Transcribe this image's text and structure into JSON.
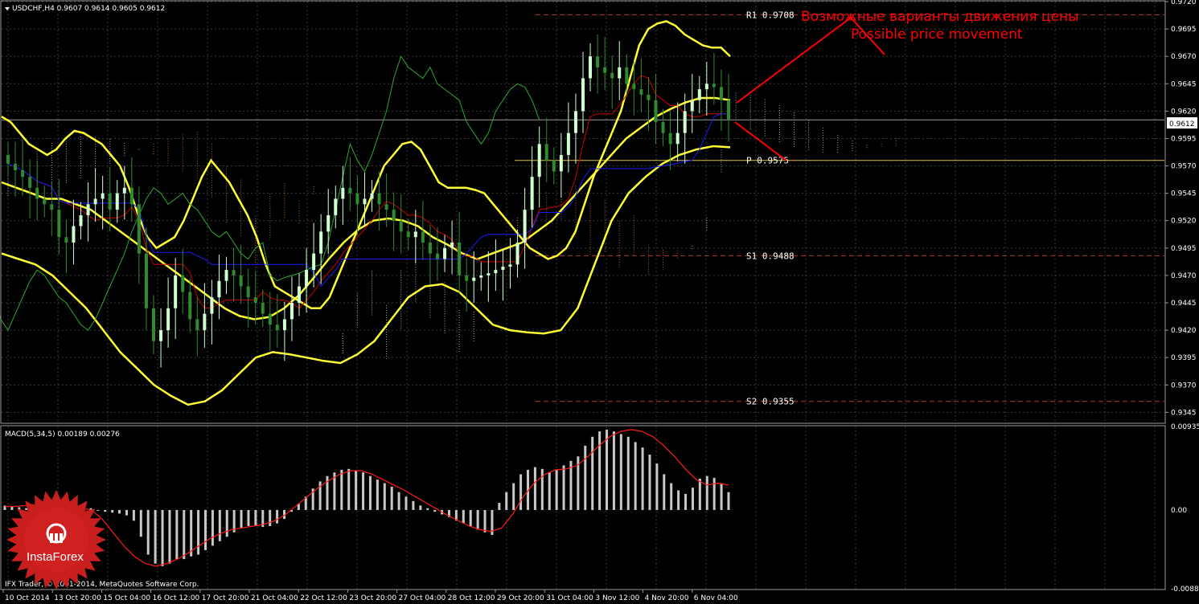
{
  "header": {
    "symbol_line": "USDCHF,H4 0.9607 0.9614 0.9605 0.9612"
  },
  "macd_header": "MACD(5,34,5) 0.00189 0.00276",
  "annotation": {
    "line1": "Возможные варианты движения цены",
    "line2": "Possible price movement"
  },
  "levels": [
    {
      "name": "R1",
      "label": "R1 0.9708",
      "value": 0.9708
    },
    {
      "name": "P",
      "label": "P 0.9575",
      "value": 0.9575
    },
    {
      "name": "S1",
      "label": "S1 0.9488",
      "value": 0.9488
    },
    {
      "name": "S2",
      "label": "S2 0.9355",
      "value": 0.9355
    }
  ],
  "current_price": "0.9612",
  "footer": "IFX Trader, © 2001-2014, MetaQuotes Software Corp.",
  "logo": {
    "text": "InstaForex"
  },
  "colors": {
    "background": "#000000",
    "grid": "#3a3a3a",
    "bull": "#d0ffd0",
    "bear": "#2e8b2e",
    "bollinger": "#ffff33",
    "tenkan": "#cc0000",
    "kijun": "#1a1aff",
    "chikou": "#2ea82e",
    "cloud": "#d8d8d8",
    "cloud_alt": "#e07a3a",
    "level_line": "#b03a2e",
    "pivot_line": "#e0c040",
    "annotation": "#ff0000",
    "macd_hist": "#c8c8c8",
    "macd_signal": "#ff1a1a",
    "logo": "#c81e1e"
  },
  "chart_data": [
    {
      "type": "candlestick",
      "title": "USDCHF,H4",
      "ylim": [
        0.9335,
        0.972
      ],
      "y_ticks": [
        "0.9720",
        "0.9695",
        "0.9670",
        "0.9645",
        "0.9620",
        "0.9595",
        "0.9570",
        "0.9545",
        "0.9520",
        "0.9495",
        "0.9470",
        "0.9445",
        "0.9420",
        "0.9395",
        "0.9370",
        "0.9345"
      ],
      "x_ticks": [
        "10 Oct 2014",
        "13 Oct 20:00",
        "15 Oct 04:00",
        "16 Oct 12:00",
        "17 Oct 20:00",
        "21 Oct 04:00",
        "22 Oct 12:00",
        "23 Oct 20:00",
        "27 Oct 04:00",
        "28 Oct 12:00",
        "29 Oct 20:00",
        "31 Oct 04:00",
        "3 Nov 12:00",
        "4 Nov 20:00",
        "6 Nov 04:00"
      ],
      "close": [
        0.9572,
        0.9566,
        0.956,
        0.955,
        0.954,
        0.9535,
        0.953,
        0.9505,
        0.95,
        0.9515,
        0.9525,
        0.9535,
        0.954,
        0.9545,
        0.953,
        0.9545,
        0.955,
        0.9535,
        0.949,
        0.944,
        0.941,
        0.942,
        0.944,
        0.947,
        0.9455,
        0.943,
        0.942,
        0.9435,
        0.945,
        0.9465,
        0.9475,
        0.947,
        0.946,
        0.945,
        0.9445,
        0.9435,
        0.9425,
        0.942,
        0.943,
        0.9445,
        0.946,
        0.9475,
        0.949,
        0.951,
        0.9525,
        0.954,
        0.955,
        0.9545,
        0.9535,
        0.954,
        0.9545,
        0.9535,
        0.953,
        0.952,
        0.951,
        0.9505,
        0.951,
        0.95,
        0.949,
        0.9485,
        0.9495,
        0.95,
        0.947,
        0.9465,
        0.9468,
        0.947,
        0.9472,
        0.9475,
        0.9478,
        0.948,
        0.95,
        0.953,
        0.956,
        0.959,
        0.9575,
        0.9565,
        0.958,
        0.96,
        0.962,
        0.965,
        0.967,
        0.966,
        0.9655,
        0.965,
        0.966,
        0.9645,
        0.964,
        0.9635,
        0.963,
        0.961,
        0.96,
        0.959,
        0.96,
        0.962,
        0.963,
        0.964,
        0.9645,
        0.9642,
        0.963,
        0.9612
      ],
      "bollinger_upper": [
        0.9615,
        0.961,
        0.96,
        0.959,
        0.9585,
        0.958,
        0.9585,
        0.9595,
        0.9602,
        0.96,
        0.9595,
        0.959,
        0.958,
        0.957,
        0.955,
        0.9525,
        0.9505,
        0.9495,
        0.95,
        0.9505,
        0.952,
        0.954,
        0.956,
        0.9575,
        0.9565,
        0.9555,
        0.954,
        0.9525,
        0.9505,
        0.948,
        0.946,
        0.9455,
        0.945,
        0.9445,
        0.944,
        0.944,
        0.945,
        0.947,
        0.949,
        0.951,
        0.953,
        0.955,
        0.957,
        0.958,
        0.959,
        0.9592,
        0.9585,
        0.957,
        0.9555,
        0.955,
        0.955,
        0.955,
        0.9548,
        0.9545,
        0.9535,
        0.9525,
        0.9515,
        0.9505,
        0.9495,
        0.949,
        0.9485,
        0.9488,
        0.9495,
        0.951,
        0.9535,
        0.956,
        0.958,
        0.96,
        0.962,
        0.965,
        0.968,
        0.9695,
        0.97,
        0.9702,
        0.9698,
        0.969,
        0.9685,
        0.968,
        0.9678,
        0.9678,
        0.967
      ],
      "bollinger_mid": [
        0.9555,
        0.955,
        0.9545,
        0.954,
        0.954,
        0.9535,
        0.953,
        0.952,
        0.951,
        0.95,
        0.949,
        0.948,
        0.947,
        0.946,
        0.945,
        0.944,
        0.9433,
        0.943,
        0.9432,
        0.944,
        0.9452,
        0.9468,
        0.9485,
        0.95,
        0.9512,
        0.952,
        0.9522,
        0.952,
        0.9515,
        0.9505,
        0.9498,
        0.949,
        0.9485,
        0.949,
        0.9495,
        0.95,
        0.951,
        0.952,
        0.9535,
        0.955,
        0.9565,
        0.958,
        0.9595,
        0.9605,
        0.9615,
        0.9622,
        0.9628,
        0.9632,
        0.9632,
        0.963
      ],
      "bollinger_lower": [
        0.949,
        0.9485,
        0.948,
        0.947,
        0.9455,
        0.944,
        0.942,
        0.94,
        0.9385,
        0.937,
        0.936,
        0.9352,
        0.9355,
        0.9365,
        0.938,
        0.9395,
        0.94,
        0.9398,
        0.9395,
        0.9392,
        0.939,
        0.9398,
        0.941,
        0.943,
        0.945,
        0.946,
        0.9462,
        0.9455,
        0.944,
        0.9425,
        0.942,
        0.9418,
        0.9417,
        0.942,
        0.944,
        0.948,
        0.952,
        0.9545,
        0.956,
        0.9572,
        0.958,
        0.9585,
        0.9588,
        0.9587
      ],
      "levels": [
        0.9708,
        0.9575,
        0.9488,
        0.9355
      ],
      "current_price": 0.9612
    },
    {
      "type": "bar",
      "title": "MACD(5,34,5)",
      "ylim": [
        -0.00882,
        0.00935
      ],
      "y_ticks": [
        "0.00935",
        "0.00",
        "-0.00882"
      ],
      "macd": 0.00189,
      "signal": 0.00276,
      "histogram": [
        0.0005,
        0.0004,
        0.0003,
        0.0002,
        0.0002,
        0.0004,
        0.0007,
        0.0008,
        0.0009,
        0.0008,
        0.0006,
        0.0004,
        0.0002,
        0.0,
        -0.0002,
        -0.0003,
        -0.0004,
        -0.0006,
        -0.0012,
        -0.003,
        -0.005,
        -0.006,
        -0.0063,
        -0.006,
        -0.0055,
        -0.0055,
        -0.0052,
        -0.005,
        -0.0045,
        -0.004,
        -0.0035,
        -0.003,
        -0.0025,
        -0.002,
        -0.0018,
        -0.0018,
        -0.0019,
        -0.0018,
        -0.0015,
        -0.001,
        -0.0002,
        0.0007,
        0.0015,
        0.0024,
        0.0032,
        0.0038,
        0.0042,
        0.0045,
        0.0046,
        0.0044,
        0.0042,
        0.0038,
        0.0034,
        0.003,
        0.0026,
        0.002,
        0.0015,
        0.001,
        0.0005,
        0.0002,
        -0.0002,
        -0.0005,
        -0.0008,
        -0.0012,
        -0.0015,
        -0.0018,
        -0.0022,
        -0.0025,
        -0.0028,
        0.0008,
        0.002,
        0.003,
        0.004,
        0.0045,
        0.0048,
        0.0046,
        0.0042,
        0.0045,
        0.005,
        0.0055,
        0.006,
        0.0072,
        0.0082,
        0.0088,
        0.009,
        0.0088,
        0.0085,
        0.0082,
        0.0076,
        0.007,
        0.0062,
        0.0052,
        0.004,
        0.003,
        0.0022,
        0.0018,
        0.0025,
        0.0035,
        0.0038,
        0.0036,
        0.003,
        0.002
      ],
      "signal_line": [
        0.0004,
        0.0004,
        0.0005,
        0.0006,
        0.0007,
        0.0006,
        0.0004,
        0.0002,
        0.0,
        -0.001,
        -0.0025,
        -0.004,
        -0.0052,
        -0.006,
        -0.0063,
        -0.006,
        -0.0055,
        -0.0048,
        -0.004,
        -0.0032,
        -0.0026,
        -0.0022,
        -0.002,
        -0.0018,
        -0.0016,
        -0.0012,
        -0.0005,
        0.0005,
        0.0015,
        0.0025,
        0.0033,
        0.004,
        0.0044,
        0.0044,
        0.004,
        0.0034,
        0.0028,
        0.0022,
        0.0015,
        0.0008,
        0.0001,
        -0.0006,
        -0.0012,
        -0.0018,
        -0.0022,
        -0.0024,
        -0.002,
        -0.0005,
        0.0015,
        0.003,
        0.004,
        0.0045,
        0.0046,
        0.005,
        0.006,
        0.0072,
        0.0082,
        0.0088,
        0.009,
        0.0088,
        0.0082,
        0.0072,
        0.006,
        0.0046,
        0.0034,
        0.0028,
        0.003,
        0.0028
      ]
    }
  ]
}
